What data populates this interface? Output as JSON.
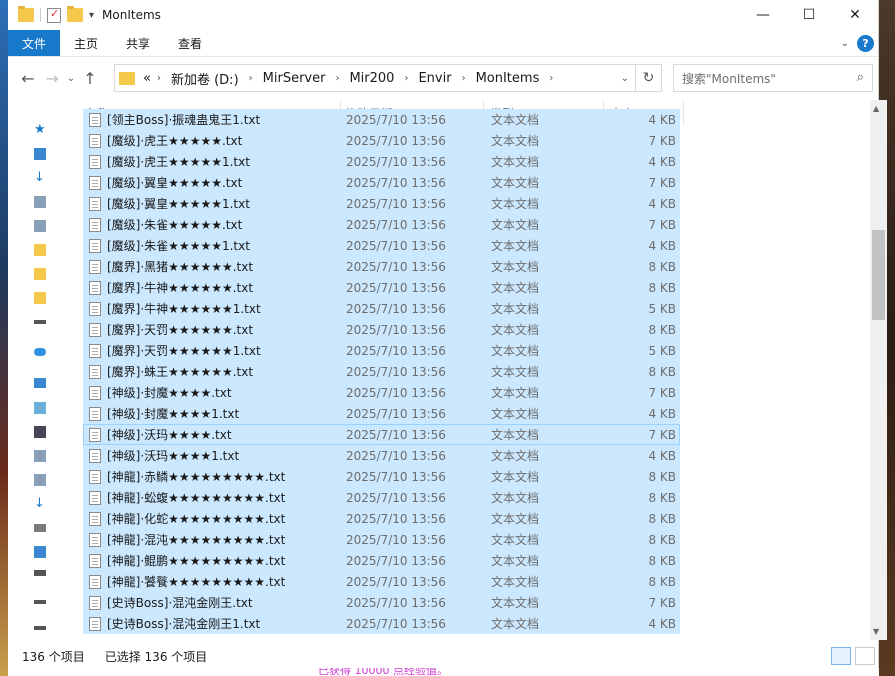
{
  "window": {
    "title": "MonItems"
  },
  "ribbon": {
    "tabs": [
      "文件",
      "主页",
      "共享",
      "查看"
    ]
  },
  "address": {
    "crumbs": [
      "新加卷 (D:)",
      "MirServer",
      "Mir200",
      "Envir",
      "MonItems"
    ],
    "overflow": "«"
  },
  "search": {
    "placeholder": "搜索\"MonItems\""
  },
  "columns": {
    "name": "名称",
    "date": "修改日期",
    "type": "类型",
    "size": "大小"
  },
  "files": [
    {
      "name": "[领主Boss]·振魂蛊鬼王1.txt",
      "date": "2025/7/10 13:56",
      "type": "文本文档",
      "size": "4 KB"
    },
    {
      "name": "[魔级]·虎王★★★★★.txt",
      "date": "2025/7/10 13:56",
      "type": "文本文档",
      "size": "7 KB"
    },
    {
      "name": "[魔级]·虎王★★★★★1.txt",
      "date": "2025/7/10 13:56",
      "type": "文本文档",
      "size": "4 KB"
    },
    {
      "name": "[魔级]·翼皇★★★★★.txt",
      "date": "2025/7/10 13:56",
      "type": "文本文档",
      "size": "7 KB"
    },
    {
      "name": "[魔级]·翼皇★★★★★1.txt",
      "date": "2025/7/10 13:56",
      "type": "文本文档",
      "size": "4 KB"
    },
    {
      "name": "[魔级]·朱雀★★★★★.txt",
      "date": "2025/7/10 13:56",
      "type": "文本文档",
      "size": "7 KB"
    },
    {
      "name": "[魔级]·朱雀★★★★★1.txt",
      "date": "2025/7/10 13:56",
      "type": "文本文档",
      "size": "4 KB"
    },
    {
      "name": "[魔界]·黑猪★★★★★★.txt",
      "date": "2025/7/10 13:56",
      "type": "文本文档",
      "size": "8 KB"
    },
    {
      "name": "[魔界]·牛神★★★★★★.txt",
      "date": "2025/7/10 13:56",
      "type": "文本文档",
      "size": "8 KB"
    },
    {
      "name": "[魔界]·牛神★★★★★★1.txt",
      "date": "2025/7/10 13:56",
      "type": "文本文档",
      "size": "5 KB"
    },
    {
      "name": "[魔界]·天罚★★★★★★.txt",
      "date": "2025/7/10 13:56",
      "type": "文本文档",
      "size": "8 KB"
    },
    {
      "name": "[魔界]·天罚★★★★★★1.txt",
      "date": "2025/7/10 13:56",
      "type": "文本文档",
      "size": "5 KB"
    },
    {
      "name": "[魔界]·蛛王★★★★★★.txt",
      "date": "2025/7/10 13:56",
      "type": "文本文档",
      "size": "8 KB"
    },
    {
      "name": "[神级]·封魔★★★★.txt",
      "date": "2025/7/10 13:56",
      "type": "文本文档",
      "size": "7 KB"
    },
    {
      "name": "[神级]·封魔★★★★1.txt",
      "date": "2025/7/10 13:56",
      "type": "文本文档",
      "size": "4 KB"
    },
    {
      "name": "[神级]·沃玛★★★★.txt",
      "date": "2025/7/10 13:56",
      "type": "文本文档",
      "size": "7 KB"
    },
    {
      "name": "[神级]·沃玛★★★★1.txt",
      "date": "2025/7/10 13:56",
      "type": "文本文档",
      "size": "4 KB"
    },
    {
      "name": "[神龍]·赤鳞★★★★★★★★★.txt",
      "date": "2025/7/10 13:56",
      "type": "文本文档",
      "size": "8 KB"
    },
    {
      "name": "[神龍]·蚣蝮★★★★★★★★★.txt",
      "date": "2025/7/10 13:56",
      "type": "文本文档",
      "size": "8 KB"
    },
    {
      "name": "[神龍]·化蛇★★★★★★★★★.txt",
      "date": "2025/7/10 13:56",
      "type": "文本文档",
      "size": "8 KB"
    },
    {
      "name": "[神龍]·混沌★★★★★★★★★.txt",
      "date": "2025/7/10 13:56",
      "type": "文本文档",
      "size": "8 KB"
    },
    {
      "name": "[神龍]·鲲鹏★★★★★★★★★.txt",
      "date": "2025/7/10 13:56",
      "type": "文本文档",
      "size": "8 KB"
    },
    {
      "name": "[神龍]·饕餮★★★★★★★★★.txt",
      "date": "2025/7/10 13:56",
      "type": "文本文档",
      "size": "8 KB"
    },
    {
      "name": "[史诗Boss]·混沌金刚王.txt",
      "date": "2025/7/10 13:56",
      "type": "文本文档",
      "size": "7 KB"
    },
    {
      "name": "[史诗Boss]·混沌金刚王1.txt",
      "date": "2025/7/10 13:56",
      "type": "文本文档",
      "size": "4 KB"
    }
  ],
  "status": {
    "count": "136 个项目",
    "selected": "已选择 136 个项目"
  },
  "background_text": "已获得 10000 点经验值。",
  "colors": {
    "selection": "#cce8ff",
    "accent": "#1979ca"
  }
}
